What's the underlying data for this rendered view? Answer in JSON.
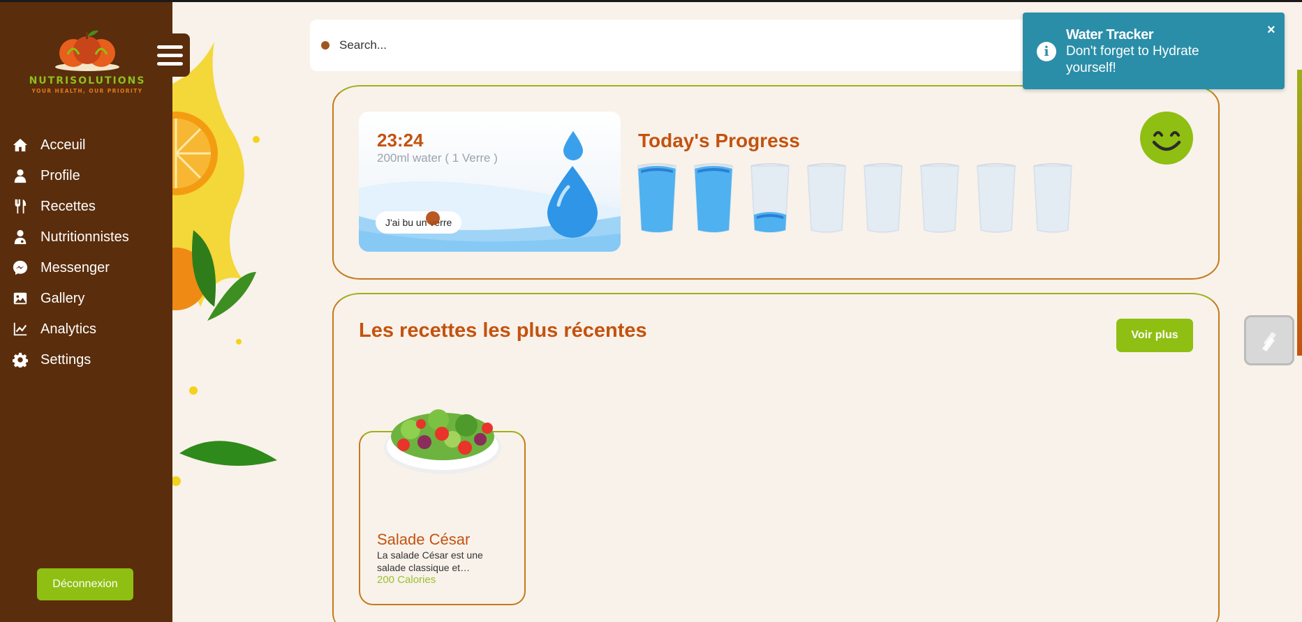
{
  "brand": {
    "name": "NUTRISOLUTIONS",
    "tagline": "YOUR HEALTH, OUR PRIORITY"
  },
  "sidebar": {
    "items": [
      {
        "label": "Acceuil",
        "icon": "home-icon"
      },
      {
        "label": "Profile",
        "icon": "user-icon"
      },
      {
        "label": "Recettes",
        "icon": "utensils-icon"
      },
      {
        "label": "Nutritionnistes",
        "icon": "doctor-icon"
      },
      {
        "label": "Messenger",
        "icon": "messenger-icon"
      },
      {
        "label": "Gallery",
        "icon": "image-icon"
      },
      {
        "label": "Analytics",
        "icon": "chart-line-icon"
      },
      {
        "label": "Settings",
        "icon": "gear-icon"
      }
    ],
    "logout_label": "Déconnexion"
  },
  "search": {
    "placeholder": "Search..."
  },
  "water": {
    "time": "23:24",
    "subtitle": "200ml water ( 1 Verre )",
    "button_label": "J'ai bu un verre",
    "progress_title": "Today's Progress",
    "glasses_fill": [
      1,
      1,
      0.25,
      0,
      0,
      0,
      0,
      0
    ]
  },
  "recipes": {
    "title": "Les recettes les plus récentes",
    "more_label": "Voir plus",
    "items": [
      {
        "title": "Salade César",
        "description": "La salade César est une salade classique et…",
        "calories": "200 Calories"
      }
    ]
  },
  "toast": {
    "title": "Water Tracker",
    "message": "Don't forget to Hydrate yourself!",
    "close_label": "×"
  },
  "colors": {
    "sidebar": "#5a2d0c",
    "accent_green": "#8fbf12",
    "accent_orange": "#c4520f",
    "toast": "#2a8ea8",
    "background": "#f8f2ea"
  }
}
